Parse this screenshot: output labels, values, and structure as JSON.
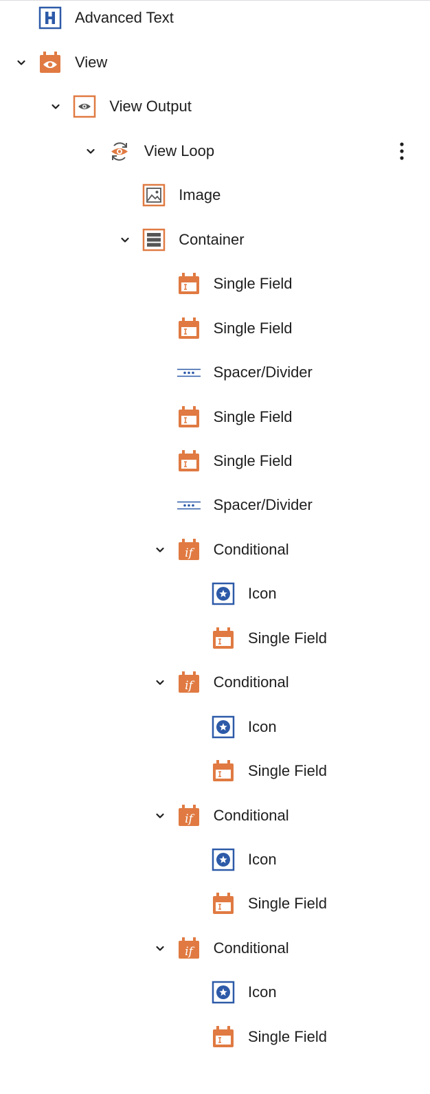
{
  "colors": {
    "accent_orange": "#e07a42",
    "accent_blue": "#2d5aa8",
    "text": "#1e1e1e",
    "chevron": "#1e1e1e",
    "loop_gray": "#555555"
  },
  "tree": {
    "items": [
      {
        "label": "Advanced Text",
        "icon": "heading-icon",
        "expanded": null
      },
      {
        "label": "View",
        "icon": "view-block-icon",
        "expanded": true
      },
      {
        "label": "View Output",
        "icon": "view-output-icon",
        "expanded": true
      },
      {
        "label": "View Loop",
        "icon": "view-loop-icon",
        "expanded": true,
        "has_options_menu": true
      },
      {
        "label": "Image",
        "icon": "image-icon",
        "expanded": null
      },
      {
        "label": "Container",
        "icon": "container-icon",
        "expanded": true
      },
      {
        "label": "Single Field",
        "icon": "single-field-icon",
        "expanded": null
      },
      {
        "label": "Single Field",
        "icon": "single-field-icon",
        "expanded": null
      },
      {
        "label": "Spacer/Divider",
        "icon": "spacer-divider-icon",
        "expanded": null
      },
      {
        "label": "Single Field",
        "icon": "single-field-icon",
        "expanded": null
      },
      {
        "label": "Single Field",
        "icon": "single-field-icon",
        "expanded": null
      },
      {
        "label": "Spacer/Divider",
        "icon": "spacer-divider-icon",
        "expanded": null
      },
      {
        "label": "Conditional",
        "icon": "conditional-icon",
        "expanded": true
      },
      {
        "label": "Icon",
        "icon": "star-icon",
        "expanded": null
      },
      {
        "label": "Single Field",
        "icon": "single-field-icon",
        "expanded": null
      },
      {
        "label": "Conditional",
        "icon": "conditional-icon",
        "expanded": true
      },
      {
        "label": "Icon",
        "icon": "star-icon",
        "expanded": null
      },
      {
        "label": "Single Field",
        "icon": "single-field-icon",
        "expanded": null
      },
      {
        "label": "Conditional",
        "icon": "conditional-icon",
        "expanded": true
      },
      {
        "label": "Icon",
        "icon": "star-icon",
        "expanded": null
      },
      {
        "label": "Single Field",
        "icon": "single-field-icon",
        "expanded": null
      },
      {
        "label": "Conditional",
        "icon": "conditional-icon",
        "expanded": true
      },
      {
        "label": "Icon",
        "icon": "star-icon",
        "expanded": null
      },
      {
        "label": "Single Field",
        "icon": "single-field-icon",
        "expanded": null
      }
    ]
  }
}
